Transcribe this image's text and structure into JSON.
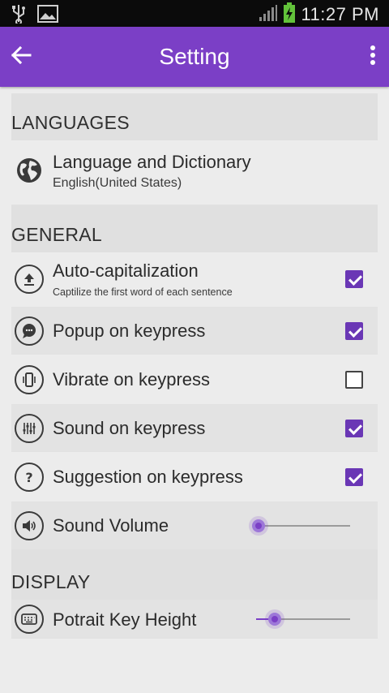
{
  "status_bar": {
    "time": "11:27 PM"
  },
  "app_bar": {
    "title": "Setting"
  },
  "sections": {
    "languages": {
      "header": "LANGUAGES",
      "language": {
        "title": "Language and Dictionary",
        "summary": "English(United States)"
      }
    },
    "general": {
      "header": "GENERAL",
      "auto_cap": {
        "title": "Auto-capitalization",
        "summary": "Captilize the first word of each sentence",
        "checked": true
      },
      "popup": {
        "title": "Popup on keypress",
        "checked": true
      },
      "vibrate": {
        "title": "Vibrate on keypress",
        "checked": false
      },
      "sound": {
        "title": "Sound on keypress",
        "checked": true
      },
      "suggestion": {
        "title": "Suggestion on keypress",
        "checked": true
      },
      "volume": {
        "title": "Sound Volume",
        "value_fraction": 0.03
      }
    },
    "display": {
      "header": "DISPLAY",
      "key_height": {
        "title": "Potrait Key Height",
        "value_fraction": 0.2
      }
    }
  },
  "colors": {
    "accent": "#7b3fc6",
    "checkbox": "#6a37b5",
    "status_bar": "#0b0b0b",
    "background": "#ececec"
  },
  "icons": {
    "language": "globe-icon",
    "auto_cap": "upload-icon",
    "popup": "chat-bubble-icon",
    "vibrate": "phone-vibrate-icon",
    "sound": "equalizer-icon",
    "suggestion": "question-icon",
    "volume": "speaker-icon",
    "key_height": "keyboard-icon"
  }
}
